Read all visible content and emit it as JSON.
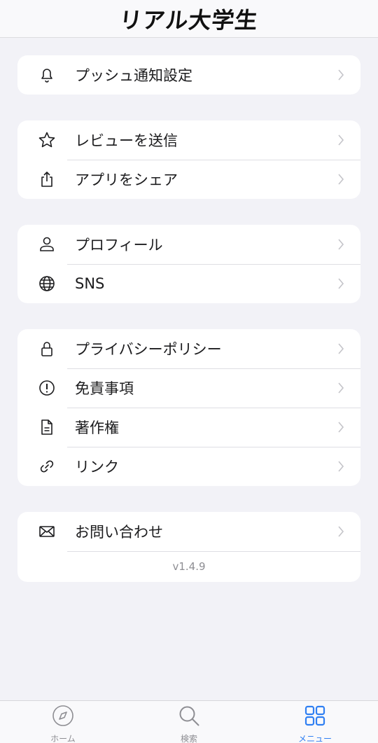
{
  "header": {
    "title": "リアル大学生"
  },
  "groups": [
    {
      "items": [
        {
          "icon": "bell-icon",
          "label": "プッシュ通知設定"
        }
      ]
    },
    {
      "items": [
        {
          "icon": "star-icon",
          "label": "レビューを送信"
        },
        {
          "icon": "share-icon",
          "label": "アプリをシェア"
        }
      ]
    },
    {
      "items": [
        {
          "icon": "person-icon",
          "label": "プロフィール"
        },
        {
          "icon": "globe-icon",
          "label": "SNS"
        }
      ]
    },
    {
      "items": [
        {
          "icon": "lock-icon",
          "label": "プライバシーポリシー"
        },
        {
          "icon": "exclamation-circle-icon",
          "label": "免責事項"
        },
        {
          "icon": "document-icon",
          "label": "著作権"
        },
        {
          "icon": "link-icon",
          "label": "リンク"
        }
      ]
    },
    {
      "items": [
        {
          "icon": "envelope-icon",
          "label": "お問い合わせ"
        }
      ],
      "version": "v1.4.9"
    }
  ],
  "tabbar": {
    "tabs": [
      {
        "icon": "compass-icon",
        "label": "ホーム",
        "active": false
      },
      {
        "icon": "magnifier-icon",
        "label": "検索",
        "active": false
      },
      {
        "icon": "grid-icon",
        "label": "メニュー",
        "active": true
      }
    ]
  },
  "colors": {
    "accent": "#2f7ff2",
    "background": "#f2f2f7",
    "inactive": "#8e8e93"
  }
}
